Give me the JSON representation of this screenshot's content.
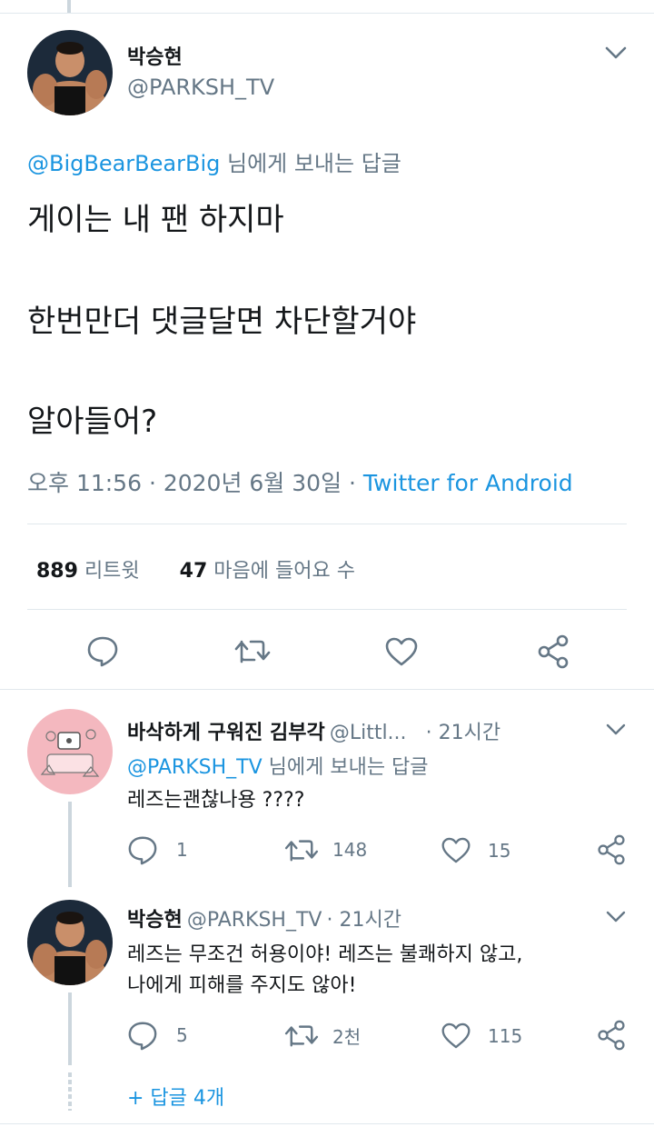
{
  "main_tweet": {
    "display_name": "박승현",
    "handle": "@PARKSH_TV",
    "reply_to_handle": "@BigBearBearBig",
    "reply_to_suffix": "님에게 보내는 답글",
    "lines": [
      "게이는 내 팬 하지마",
      "한번만더 댓글달면 차단할거야",
      "알아들어?"
    ],
    "timestamp": "오후 11:56 · 2020년 6월 30일 · ",
    "source": "Twitter for Android",
    "retweets_count": "889",
    "retweets_label": "리트윗",
    "likes_count": "47",
    "likes_label": "마음에 들어요 수"
  },
  "replies": [
    {
      "display_name": "바삭하게 구워진 김부각",
      "handle": "@Littl...",
      "time": "· 21시간",
      "reply_to_handle": "@PARKSH_TV",
      "reply_to_suffix": "님에게 보내는 답글",
      "text_lines": [
        "레즈는괜찮나용 ????"
      ],
      "reply_count": "1",
      "retweet_count": "148",
      "like_count": "15"
    },
    {
      "display_name": "박승현",
      "handle": "@PARKSH_TV",
      "time": "· 21시간",
      "text_lines": [
        "레즈는 무조건 허용이야! 레즈는 불쾌하지 않고,",
        "나에게 피해를 주지도 않아!"
      ],
      "reply_count": "5",
      "retweet_count": "2천",
      "like_count": "115",
      "more_replies": "+ 답글 4개"
    }
  ],
  "colors": {
    "accent": "#1b95e0",
    "secondary_text": "#657786",
    "divider": "#e1e8ed",
    "thread_line": "#ccd6dd"
  },
  "icons": {
    "reply": "reply-icon",
    "retweet": "retweet-icon",
    "like": "heart-icon",
    "share": "share-icon",
    "more": "chevron-down-icon"
  }
}
